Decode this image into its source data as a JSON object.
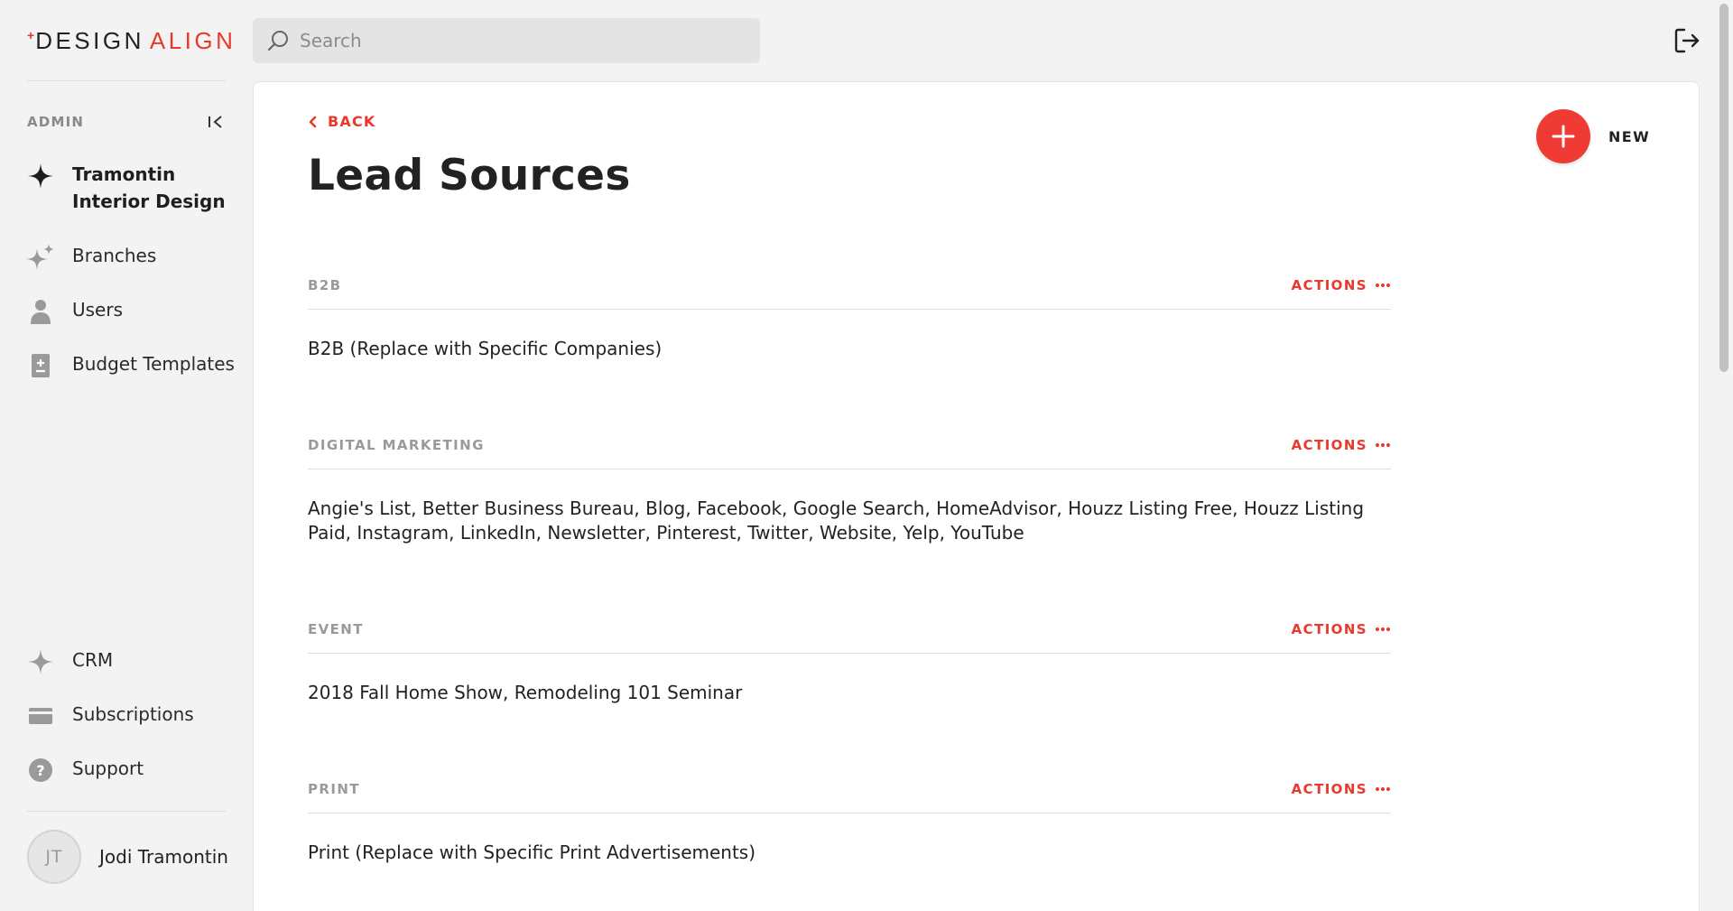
{
  "brand": {
    "logo_plus": "+",
    "logo_part1": "DESIGN",
    "logo_part2": "ALIGN",
    "accent": "#e8392c"
  },
  "search": {
    "placeholder": "Search",
    "value": ""
  },
  "sidebar": {
    "section_label": "ADMIN",
    "company": {
      "line1": "Tramontin",
      "line2": "Interior Design",
      "icon": "sparkle-icon"
    },
    "items": [
      {
        "label": "Branches",
        "icon": "sparkles-icon"
      },
      {
        "label": "Users",
        "icon": "person-icon"
      },
      {
        "label": "Budget Templates",
        "icon": "document-plus-icon"
      }
    ],
    "bottom_items": [
      {
        "label": "CRM",
        "icon": "sparkle-icon"
      },
      {
        "label": "Subscriptions",
        "icon": "credit-card-icon"
      },
      {
        "label": "Support",
        "icon": "help-circle-icon"
      }
    ],
    "user": {
      "initials": "JT",
      "name": "Jodi Tramontin"
    }
  },
  "main": {
    "back_label": "BACK",
    "title": "Lead Sources",
    "new_label": "NEW",
    "actions_label": "ACTIONS",
    "sections": [
      {
        "title": "B2B",
        "body": "B2B (Replace with Specific Companies)"
      },
      {
        "title": "DIGITAL MARKETING",
        "body": "Angie's List, Better Business Bureau, Blog, Facebook, Google Search, HomeAdvisor, Houzz Listing Free, Houzz Listing Paid, Instagram, LinkedIn, Newsletter, Pinterest, Twitter, Website, Yelp, YouTube"
      },
      {
        "title": "EVENT",
        "body": "2018 Fall Home Show, Remodeling 101 Seminar"
      },
      {
        "title": "PRINT",
        "body": "Print (Replace with Specific Print Advertisements)"
      }
    ]
  }
}
